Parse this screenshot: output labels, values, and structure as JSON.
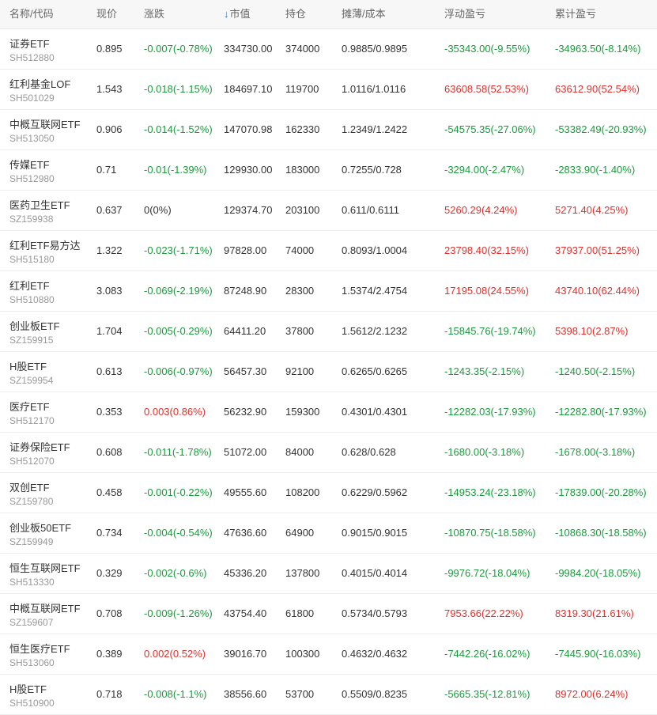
{
  "header": {
    "name_code": "名称/代码",
    "price": "现价",
    "change": "涨跌",
    "market_value": "市值",
    "holding": "持仓",
    "cost": "摊薄/成本",
    "float_pl": "浮动盈亏",
    "cum_pl": "累计盈亏"
  },
  "colors": {
    "up": "#e0302c",
    "down": "#1a9b3c",
    "sort": "#2a77d6"
  },
  "rows": [
    {
      "name": "证券ETF",
      "code": "SH512880",
      "price": "0.895",
      "change": "-0.007(-0.78%)",
      "mv": "334730.00",
      "qty": "374000",
      "cost": "0.9885/0.9895",
      "float": "-35343.00(-9.55%)",
      "cum": "-34963.50(-8.14%)"
    },
    {
      "name": "红利基金LOF",
      "code": "SH501029",
      "price": "1.543",
      "change": "-0.018(-1.15%)",
      "mv": "184697.10",
      "qty": "119700",
      "cost": "1.0116/1.0116",
      "float": "63608.58(52.53%)",
      "cum": "63612.90(52.54%)"
    },
    {
      "name": "中概互联网ETF",
      "code": "SH513050",
      "price": "0.906",
      "change": "-0.014(-1.52%)",
      "mv": "147070.98",
      "qty": "162330",
      "cost": "1.2349/1.2422",
      "float": "-54575.35(-27.06%)",
      "cum": "-53382.49(-20.93%)"
    },
    {
      "name": "传媒ETF",
      "code": "SH512980",
      "price": "0.71",
      "change": "-0.01(-1.39%)",
      "mv": "129930.00",
      "qty": "183000",
      "cost": "0.7255/0.728",
      "float": "-3294.00(-2.47%)",
      "cum": "-2833.90(-1.40%)"
    },
    {
      "name": "医药卫生ETF",
      "code": "SZ159938",
      "price": "0.637",
      "change": "0(0%)",
      "mv": "129374.70",
      "qty": "203100",
      "cost": "0.611/0.6111",
      "float": "5260.29(4.24%)",
      "cum": "5271.40(4.25%)"
    },
    {
      "name": "红利ETF易方达",
      "code": "SH515180",
      "price": "1.322",
      "change": "-0.023(-1.71%)",
      "mv": "97828.00",
      "qty": "74000",
      "cost": "0.8093/1.0004",
      "float": "23798.40(32.15%)",
      "cum": "37937.00(51.25%)"
    },
    {
      "name": "红利ETF",
      "code": "SH510880",
      "price": "3.083",
      "change": "-0.069(-2.19%)",
      "mv": "87248.90",
      "qty": "28300",
      "cost": "1.5374/2.4754",
      "float": "17195.08(24.55%)",
      "cum": "43740.10(62.44%)"
    },
    {
      "name": "创业板ETF",
      "code": "SZ159915",
      "price": "1.704",
      "change": "-0.005(-0.29%)",
      "mv": "64411.20",
      "qty": "37800",
      "cost": "1.5612/2.1232",
      "float": "-15845.76(-19.74%)",
      "cum": "5398.10(2.87%)"
    },
    {
      "name": "H股ETF",
      "code": "SZ159954",
      "price": "0.613",
      "change": "-0.006(-0.97%)",
      "mv": "56457.30",
      "qty": "92100",
      "cost": "0.6265/0.6265",
      "float": "-1243.35(-2.15%)",
      "cum": "-1240.50(-2.15%)"
    },
    {
      "name": "医疗ETF",
      "code": "SH512170",
      "price": "0.353",
      "change": "0.003(0.86%)",
      "mv": "56232.90",
      "qty": "159300",
      "cost": "0.4301/0.4301",
      "float": "-12282.03(-17.93%)",
      "cum": "-12282.80(-17.93%)"
    },
    {
      "name": "证券保险ETF",
      "code": "SH512070",
      "price": "0.608",
      "change": "-0.011(-1.78%)",
      "mv": "51072.00",
      "qty": "84000",
      "cost": "0.628/0.628",
      "float": "-1680.00(-3.18%)",
      "cum": "-1678.00(-3.18%)"
    },
    {
      "name": "双创ETF",
      "code": "SZ159780",
      "price": "0.458",
      "change": "-0.001(-0.22%)",
      "mv": "49555.60",
      "qty": "108200",
      "cost": "0.6229/0.5962",
      "float": "-14953.24(-23.18%)",
      "cum": "-17839.00(-20.28%)"
    },
    {
      "name": "创业板50ETF",
      "code": "SZ159949",
      "price": "0.734",
      "change": "-0.004(-0.54%)",
      "mv": "47636.60",
      "qty": "64900",
      "cost": "0.9015/0.9015",
      "float": "-10870.75(-18.58%)",
      "cum": "-10868.30(-18.58%)"
    },
    {
      "name": "恒生互联网ETF",
      "code": "SH513330",
      "price": "0.329",
      "change": "-0.002(-0.6%)",
      "mv": "45336.20",
      "qty": "137800",
      "cost": "0.4015/0.4014",
      "float": "-9976.72(-18.04%)",
      "cum": "-9984.20(-18.05%)"
    },
    {
      "name": "中概互联网ETF",
      "code": "SZ159607",
      "price": "0.708",
      "change": "-0.009(-1.26%)",
      "mv": "43754.40",
      "qty": "61800",
      "cost": "0.5734/0.5793",
      "float": "7953.66(22.22%)",
      "cum": "8319.30(21.61%)"
    },
    {
      "name": "恒生医疗ETF",
      "code": "SH513060",
      "price": "0.389",
      "change": "0.002(0.52%)",
      "mv": "39016.70",
      "qty": "100300",
      "cost": "0.4632/0.4632",
      "float": "-7442.26(-16.02%)",
      "cum": "-7445.90(-16.03%)"
    },
    {
      "name": "H股ETF",
      "code": "SH510900",
      "price": "0.718",
      "change": "-0.008(-1.1%)",
      "mv": "38556.60",
      "qty": "53700",
      "cost": "0.5509/0.8235",
      "float": "-5665.35(-12.81%)",
      "cum": "8972.00(6.24%)"
    }
  ]
}
